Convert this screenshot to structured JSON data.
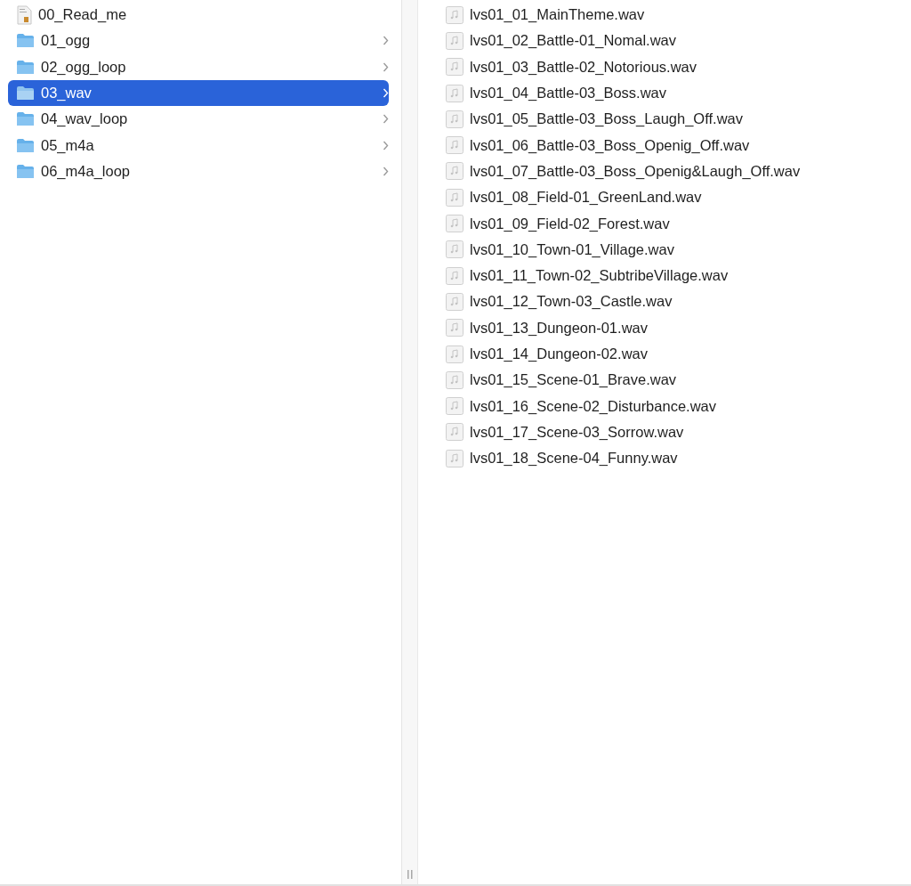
{
  "left_column": {
    "items": [
      {
        "kind": "document",
        "name": "00_Read_me",
        "selected": false
      },
      {
        "kind": "folder",
        "name": "01_ogg",
        "selected": false
      },
      {
        "kind": "folder",
        "name": "02_ogg_loop",
        "selected": false
      },
      {
        "kind": "folder",
        "name": "03_wav",
        "selected": true
      },
      {
        "kind": "folder",
        "name": "04_wav_loop",
        "selected": false
      },
      {
        "kind": "folder",
        "name": "05_m4a",
        "selected": false
      },
      {
        "kind": "folder",
        "name": "06_m4a_loop",
        "selected": false
      }
    ]
  },
  "right_column": {
    "items": [
      {
        "name": "lvs01_01_MainTheme.wav"
      },
      {
        "name": "lvs01_02_Battle-01_Nomal.wav"
      },
      {
        "name": "lvs01_03_Battle-02_Notorious.wav"
      },
      {
        "name": "lvs01_04_Battle-03_Boss.wav"
      },
      {
        "name": "lvs01_05_Battle-03_Boss_Laugh_Off.wav"
      },
      {
        "name": "lvs01_06_Battle-03_Boss_Openig_Off.wav"
      },
      {
        "name": "lvs01_07_Battle-03_Boss_Openig&Laugh_Off.wav"
      },
      {
        "name": "lvs01_08_Field-01_GreenLand.wav"
      },
      {
        "name": "lvs01_09_Field-02_Forest.wav"
      },
      {
        "name": "lvs01_10_Town-01_Village.wav"
      },
      {
        "name": "lvs01_11_Town-02_SubtribeVillage.wav"
      },
      {
        "name": "lvs01_12_Town-03_Castle.wav"
      },
      {
        "name": "lvs01_13_Dungeon-01.wav"
      },
      {
        "name": "lvs01_14_Dungeon-02.wav"
      },
      {
        "name": "lvs01_15_Scene-01_Brave.wav"
      },
      {
        "name": "lvs01_16_Scene-02_Disturbance.wav"
      },
      {
        "name": "lvs01_17_Scene-03_Sorrow.wav"
      },
      {
        "name": "lvs01_18_Scene-04_Funny.wav"
      }
    ]
  }
}
